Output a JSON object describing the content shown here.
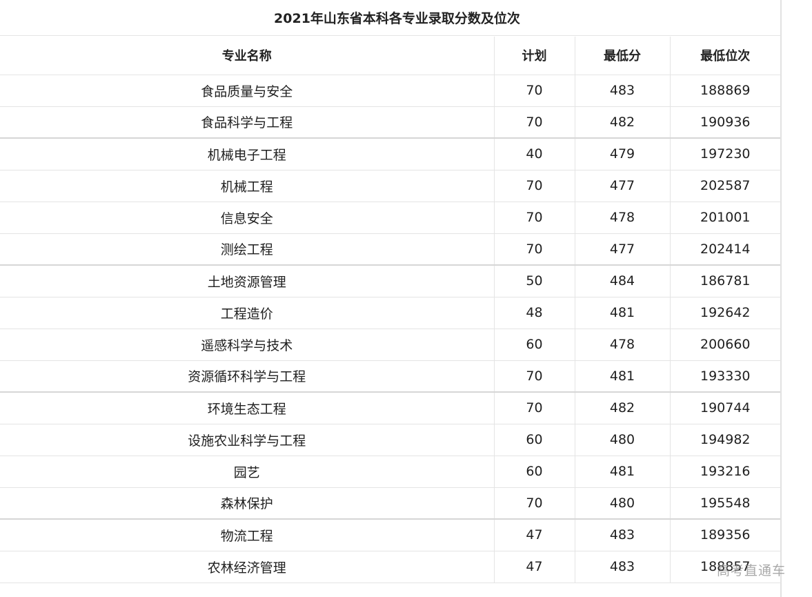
{
  "title": "2021年山东省本科各专业录取分数及位次",
  "headers": {
    "name": "专业名称",
    "plan": "计划",
    "min_score": "最低分",
    "min_rank": "最低位次"
  },
  "rows": [
    {
      "name": "食品质量与安全",
      "plan": "70",
      "min_score": "483",
      "min_rank": "188869"
    },
    {
      "name": "食品科学与工程",
      "plan": "70",
      "min_score": "482",
      "min_rank": "190936"
    },
    {
      "name": "机械电子工程",
      "plan": "40",
      "min_score": "479",
      "min_rank": "197230"
    },
    {
      "name": "机械工程",
      "plan": "70",
      "min_score": "477",
      "min_rank": "202587"
    },
    {
      "name": "信息安全",
      "plan": "70",
      "min_score": "478",
      "min_rank": "201001"
    },
    {
      "name": "测绘工程",
      "plan": "70",
      "min_score": "477",
      "min_rank": "202414"
    },
    {
      "name": "土地资源管理",
      "plan": "50",
      "min_score": "484",
      "min_rank": "186781"
    },
    {
      "name": "工程造价",
      "plan": "48",
      "min_score": "481",
      "min_rank": "192642"
    },
    {
      "name": "遥感科学与技术",
      "plan": "60",
      "min_score": "478",
      "min_rank": "200660"
    },
    {
      "name": "资源循环科学与工程",
      "plan": "70",
      "min_score": "481",
      "min_rank": "193330"
    },
    {
      "name": "环境生态工程",
      "plan": "70",
      "min_score": "482",
      "min_rank": "190744"
    },
    {
      "name": "设施农业科学与工程",
      "plan": "60",
      "min_score": "480",
      "min_rank": "194982"
    },
    {
      "name": "园艺",
      "plan": "60",
      "min_score": "481",
      "min_rank": "193216"
    },
    {
      "name": "森林保护",
      "plan": "70",
      "min_score": "480",
      "min_rank": "195548"
    },
    {
      "name": "物流工程",
      "plan": "47",
      "min_score": "483",
      "min_rank": "189356"
    },
    {
      "name": "农林经济管理",
      "plan": "47",
      "min_score": "483",
      "min_rank": "188857"
    }
  ],
  "watermark": "高考直通车"
}
